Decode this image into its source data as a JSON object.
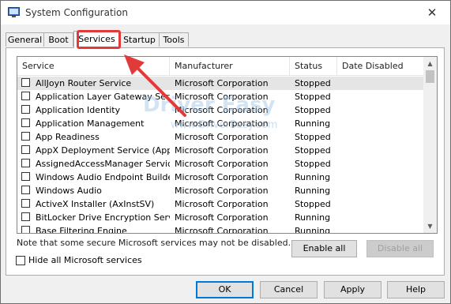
{
  "window": {
    "title": "System Configuration",
    "close_glyph": "✕"
  },
  "tabs": [
    {
      "label": "General",
      "active": false
    },
    {
      "label": "Boot",
      "active": false
    },
    {
      "label": "Services",
      "active": true
    },
    {
      "label": "Startup",
      "active": false
    },
    {
      "label": "Tools",
      "active": false
    }
  ],
  "table": {
    "headers": [
      "Service",
      "Manufacturer",
      "Status",
      "Date Disabled"
    ],
    "rows": [
      {
        "service": "AllJoyn Router Service",
        "manufacturer": "Microsoft Corporation",
        "status": "Stopped",
        "date_disabled": "",
        "checked": false,
        "highlighted": true
      },
      {
        "service": "Application Layer Gateway Service",
        "manufacturer": "Microsoft Corporation",
        "status": "Stopped",
        "date_disabled": "",
        "checked": false
      },
      {
        "service": "Application Identity",
        "manufacturer": "Microsoft Corporation",
        "status": "Stopped",
        "date_disabled": "",
        "checked": false
      },
      {
        "service": "Application Management",
        "manufacturer": "Microsoft Corporation",
        "status": "Running",
        "date_disabled": "",
        "checked": false
      },
      {
        "service": "App Readiness",
        "manufacturer": "Microsoft Corporation",
        "status": "Stopped",
        "date_disabled": "",
        "checked": false
      },
      {
        "service": "AppX Deployment Service (AppX...",
        "manufacturer": "Microsoft Corporation",
        "status": "Stopped",
        "date_disabled": "",
        "checked": false
      },
      {
        "service": "AssignedAccessManager Service",
        "manufacturer": "Microsoft Corporation",
        "status": "Stopped",
        "date_disabled": "",
        "checked": false
      },
      {
        "service": "Windows Audio Endpoint Builder",
        "manufacturer": "Microsoft Corporation",
        "status": "Running",
        "date_disabled": "",
        "checked": false
      },
      {
        "service": "Windows Audio",
        "manufacturer": "Microsoft Corporation",
        "status": "Running",
        "date_disabled": "",
        "checked": false
      },
      {
        "service": "ActiveX Installer (AxInstSV)",
        "manufacturer": "Microsoft Corporation",
        "status": "Stopped",
        "date_disabled": "",
        "checked": false
      },
      {
        "service": "BitLocker Drive Encryption Service",
        "manufacturer": "Microsoft Corporation",
        "status": "Running",
        "date_disabled": "",
        "checked": false
      },
      {
        "service": "Base Filtering Engine",
        "manufacturer": "Microsoft Corporation",
        "status": "Running",
        "date_disabled": "",
        "checked": false
      }
    ]
  },
  "note": "Note that some secure Microsoft services may not be disabled.",
  "buttons": {
    "enable_all": "Enable all",
    "disable_all": "Disable all",
    "ok": "OK",
    "cancel": "Cancel",
    "apply": "Apply",
    "help": "Help"
  },
  "hide_ms": {
    "label": "Hide all Microsoft services",
    "checked": false
  },
  "watermark": {
    "main": "Driver Easy",
    "sub": "www.DriverEasy.com"
  },
  "colors": {
    "annotation_red": "#e03a3a",
    "focus_blue": "#0078d7"
  }
}
